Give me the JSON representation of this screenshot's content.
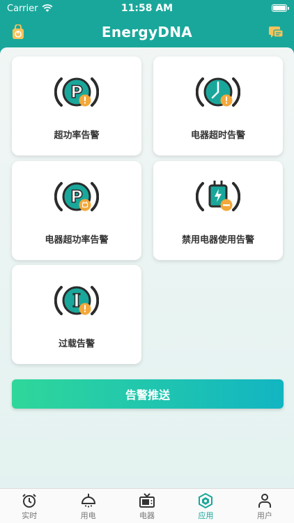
{
  "status_bar": {
    "carrier": "Carrier",
    "time": "11:58 AM"
  },
  "nav": {
    "title": "EnergyDNA"
  },
  "colors": {
    "primary": "#1aa79b",
    "warn": "#f2a83a",
    "dark": "#2b2b2b",
    "button_start": "#2fd79a",
    "button_end": "#12b5c2"
  },
  "cards": [
    {
      "label": "超功率告警",
      "icon": "power-p-warning-icon"
    },
    {
      "label": "电器超时告警",
      "icon": "clock-warning-icon"
    },
    {
      "label": "电器超功率告警",
      "icon": "power-p-appliance-icon"
    },
    {
      "label": "禁用电器使用告警",
      "icon": "banned-plug-icon"
    },
    {
      "label": "过载告警",
      "icon": "current-i-warning-icon"
    }
  ],
  "push_button": {
    "label": "告警推送"
  },
  "tabs": [
    {
      "label": "实时",
      "icon": "alarm-clock-icon",
      "active": false
    },
    {
      "label": "用电",
      "icon": "lamp-icon",
      "active": false
    },
    {
      "label": "电器",
      "icon": "tv-icon",
      "active": false
    },
    {
      "label": "应用",
      "icon": "hexagon-app-icon",
      "active": true
    },
    {
      "label": "用户",
      "icon": "user-icon",
      "active": false
    }
  ]
}
